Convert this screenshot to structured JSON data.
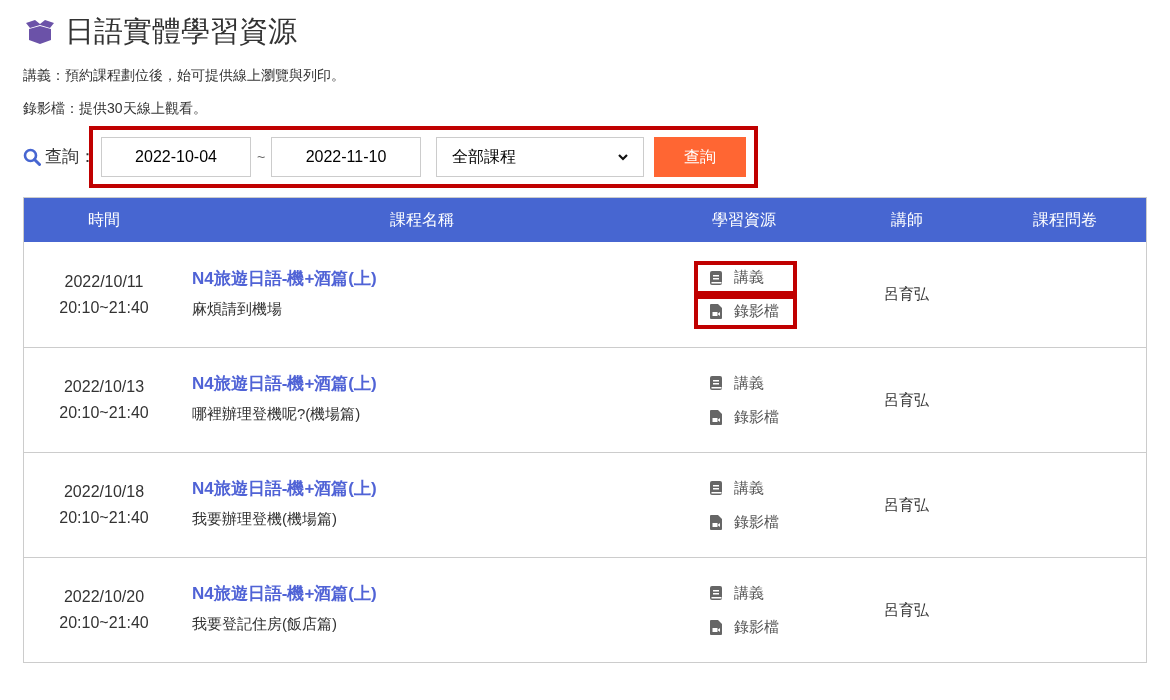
{
  "title": "日語實體學習資源",
  "notes": [
    "講義：預約課程劃位後，始可提供線上瀏覽與列印。",
    "錄影檔：提供30天線上觀看。"
  ],
  "query": {
    "label": "查詢：",
    "highlighted": true,
    "start_date": "2022-10-04",
    "separator": "~",
    "end_date": "2022-11-10",
    "course_select": "全部課程",
    "button": "查詢"
  },
  "table": {
    "columns": [
      "時間",
      "課程名稱",
      "學習資源",
      "講師",
      "課程問卷"
    ],
    "rows": [
      {
        "date": "2022/10/11",
        "time": "20:10~21:40",
        "course": "N4旅遊日語-機+酒篇(上)",
        "lesson": "麻煩請到機場",
        "resources": [
          {
            "kind": "handout",
            "label": "講義",
            "highlighted": true
          },
          {
            "kind": "video",
            "label": "錄影檔",
            "highlighted": true
          }
        ],
        "teacher": "呂育弘"
      },
      {
        "date": "2022/10/13",
        "time": "20:10~21:40",
        "course": "N4旅遊日語-機+酒篇(上)",
        "lesson": "哪裡辦理登機呢?(機場篇)",
        "resources": [
          {
            "kind": "handout",
            "label": "講義",
            "highlighted": false
          },
          {
            "kind": "video",
            "label": "錄影檔",
            "highlighted": false
          }
        ],
        "teacher": "呂育弘"
      },
      {
        "date": "2022/10/18",
        "time": "20:10~21:40",
        "course": "N4旅遊日語-機+酒篇(上)",
        "lesson": "我要辦理登機(機場篇)",
        "resources": [
          {
            "kind": "handout",
            "label": "講義",
            "highlighted": false
          },
          {
            "kind": "video",
            "label": "錄影檔",
            "highlighted": false
          }
        ],
        "teacher": "呂育弘"
      },
      {
        "date": "2022/10/20",
        "time": "20:10~21:40",
        "course": "N4旅遊日語-機+酒篇(上)",
        "lesson": "我要登記住房(飯店篇)",
        "resources": [
          {
            "kind": "handout",
            "label": "講義",
            "highlighted": false
          },
          {
            "kind": "video",
            "label": "錄影檔",
            "highlighted": false
          }
        ],
        "teacher": "呂育弘"
      }
    ]
  }
}
